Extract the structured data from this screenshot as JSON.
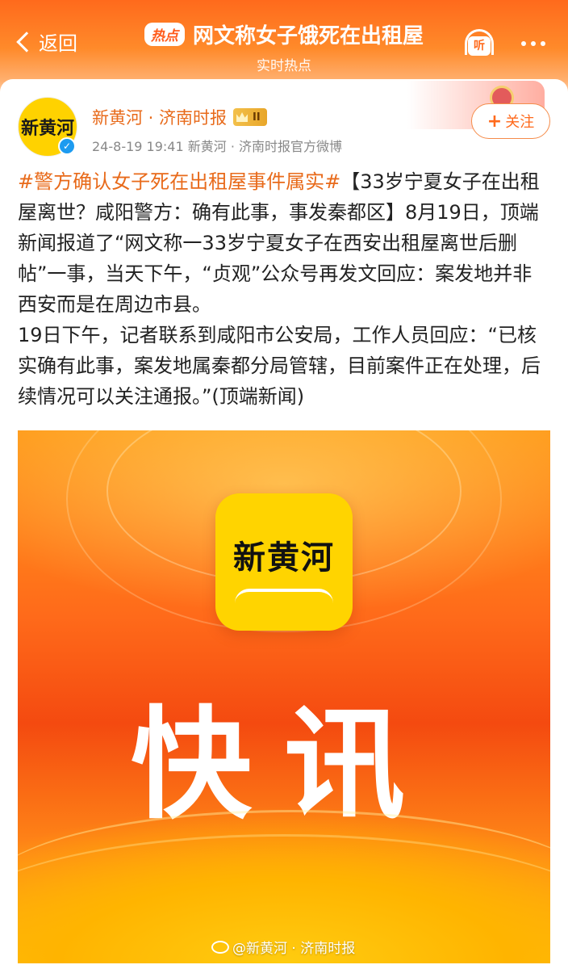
{
  "header": {
    "back_label": "返回",
    "hot_tag": "热点",
    "title": "网文称女子饿死在出租屋",
    "subtitle": "实时热点",
    "listen_label": "听"
  },
  "post": {
    "avatar_logo": "新黄河",
    "author": "新黄河 · 济南时报",
    "rank_badge": "II",
    "meta": "24-8-19 19:41  新黄河 · 济南时报官方微博",
    "follow_label": "关注",
    "hashtag": "#警方确认女子死在出租屋事件属实#",
    "body_1": "【33岁宁夏女子在出租屋离世？咸阳警方：确有此事，事发秦都区】8月19日，顶端新闻报道了“网文称一33岁宁夏女子在西安出租屋离世后删帖”一事，当天下午，“贞观”公众号再发文回应：案发地并非西安而是在周边市县。",
    "body_2": "19日下午，记者联系到咸阳市公安局，工作人员回应：“已核实确有此事，案发地属秦都分局管辖，目前案件正在处理，后续情况可以关注通报。”(顶端新闻)"
  },
  "image": {
    "app_logo": "新黄河",
    "headline": "快讯",
    "watermark": "@新黄河 · 济南时报"
  },
  "colors": {
    "accent": "#ff6a1c",
    "hashtag": "#e86a1a",
    "verified": "#1d9bf0"
  }
}
